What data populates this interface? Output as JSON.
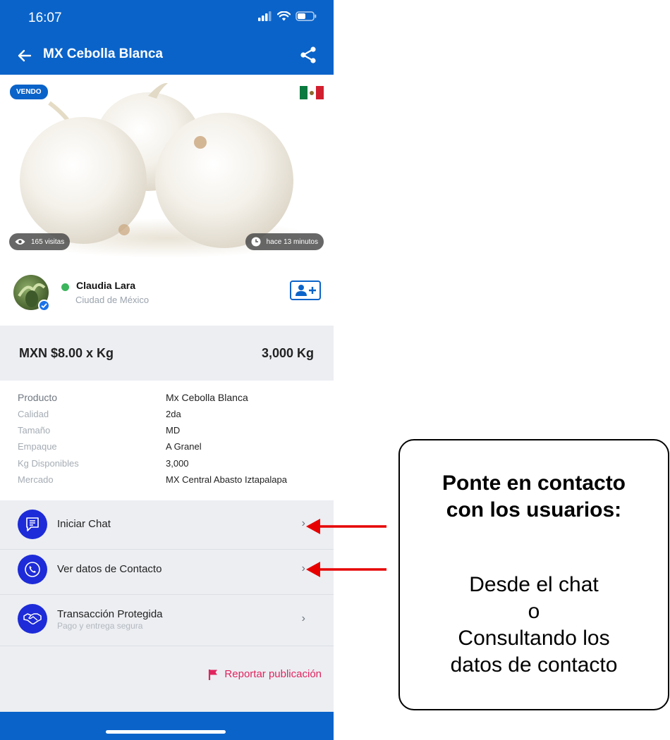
{
  "status_bar": {
    "time": "16:07",
    "icons": [
      "signal-icon",
      "wifi-icon",
      "battery-icon"
    ]
  },
  "app_bar": {
    "title": "MX Cebolla Blanca",
    "back_icon": "arrow-left-icon",
    "share_icon": "share-icon"
  },
  "listing": {
    "badge": "VENDO",
    "country_flag": "mexico-flag-icon",
    "visits": "165 visitas",
    "posted": "hace 13 minutos"
  },
  "seller": {
    "name": "Claudia Lara",
    "city": "Ciudad de México",
    "online": true,
    "verified": true
  },
  "price": {
    "unit_price": "MXN $8.00 x Kg",
    "quantity": "3,000 Kg"
  },
  "details": [
    {
      "label": "Producto",
      "value": "Mx Cebolla Blanca"
    },
    {
      "label": "Calidad",
      "value": "2da"
    },
    {
      "label": "Tamaño",
      "value": "MD"
    },
    {
      "label": "Empaque",
      "value": "A Granel"
    },
    {
      "label": "Kg Disponibles",
      "value": "3,000"
    },
    {
      "label": "Mercado",
      "value": "MX Central Abasto Iztapalapa"
    }
  ],
  "actions": [
    {
      "label": "Iniciar Chat",
      "sub": "",
      "icon": "chat-icon"
    },
    {
      "label": "Ver datos de Contacto",
      "sub": "",
      "icon": "phone-icon"
    },
    {
      "label": "Transacción Protegida",
      "sub": "Pago y entrega segura",
      "icon": "handshake-icon"
    }
  ],
  "report": {
    "label": "Reportar publicación",
    "icon": "flag-icon"
  },
  "colors": {
    "primary": "#0a63c9",
    "action_circle": "#1d2bd8",
    "report": "#e0245e",
    "arrow": "#e60000",
    "online": "#3cb55c"
  },
  "callout": {
    "heading_line1": "Ponte en contacto",
    "heading_line2": "con los usuarios:",
    "body_line1": "Desde el chat",
    "body_line2": "o",
    "body_line3": "Consultando los",
    "body_line4": "datos de contacto"
  }
}
